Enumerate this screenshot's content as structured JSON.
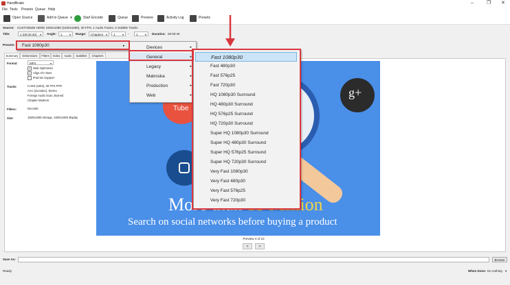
{
  "app": {
    "title": "HandBrake",
    "minimize": "–",
    "restore": "❐",
    "close": "✕"
  },
  "menubar": [
    "File",
    "Tools",
    "Presets",
    "Queue",
    "Help"
  ],
  "toolbar": {
    "open_source": "Open Source",
    "add_to_queue": "Add to Queue",
    "add_to_queue_arrow": "▾",
    "start_encode": "Start Encode",
    "queue": "Queue",
    "preview": "Preview",
    "activity_log": "Activity Log",
    "presets": "Presets"
  },
  "source": {
    "label": "Source:",
    "value": "CUSTOMIZE HERE   1920x1080 (1920x1080), 30 FPS, 1 Audio Tracks, 0 Subtitle Tracks"
  },
  "title_row": {
    "title_label": "Title:",
    "title_value": "1 (00:00:40)",
    "angle_label": "Angle:",
    "angle_value": "1",
    "range_label": "Range:",
    "range_mode": "Chapters",
    "range_start": "1",
    "range_sep": "-",
    "range_end": "1",
    "duration_label": "Duration:",
    "duration_value": "00:00:40"
  },
  "presets_row": {
    "label": "Presets:",
    "value": "Fast 1080p30"
  },
  "tabs": [
    "Summary",
    "Dimensions",
    "Filters",
    "Video",
    "Audio",
    "Subtitles",
    "Chapters"
  ],
  "summary": {
    "format_label": "Format:",
    "format_value": "MP4",
    "web_optimized": "Web Optimized",
    "align_av": "Align A/V Start",
    "ipod": "iPod 5G Support",
    "tracks_label": "Tracks:",
    "tracks": [
      "H.264 (x264), 30 FPS PFR",
      "AAC (avcodec), Stereo",
      "Foreign Audio Scan, Burned",
      "Chapter Markers"
    ],
    "filters_label": "Filters:",
    "filters_value": "Decomb",
    "size_label": "Size:",
    "size_value": "1920x1080 storage, 1920x1080 display"
  },
  "preview": {
    "headline_a": "More than ",
    "headline_b": "15 Million",
    "subline": "Search on social networks before buying a product",
    "tube_label": "Tube",
    "gplus": "g+",
    "counter": "Preview 4 of 10",
    "prev": "<",
    "next": ">"
  },
  "save_as": {
    "label": "Save As:",
    "browse": "Browse"
  },
  "status": {
    "ready": "Ready",
    "when_done_label": "When Done:",
    "when_done_value": "Do nothing"
  },
  "preset_menu": {
    "current": "Fast 1080p30",
    "categories": [
      "Devices",
      "General",
      "Legacy",
      "Matroska",
      "Production",
      "Web"
    ],
    "general": [
      "Fast 1080p30",
      "Fast 480p30",
      "Fast 576p25",
      "Fast 720p30",
      "HQ 1080p30 Surround",
      "HQ 480p30 Surround",
      "HQ 576p25 Surround",
      "HQ 720p30 Surround",
      "Super HQ 1080p30 Surround",
      "Super HQ 480p30 Surround",
      "Super HQ 576p25 Surround",
      "Super HQ 720p30 Surround",
      "Very Fast 1080p30",
      "Very Fast 480p30",
      "Very Fast 576p25",
      "Very Fast 720p30"
    ]
  },
  "colors": {
    "highlight": "#d9363e",
    "preview_bg": "#4a8fe8",
    "accent_yellow": "#f5d547",
    "selection": "#cce4f7"
  }
}
